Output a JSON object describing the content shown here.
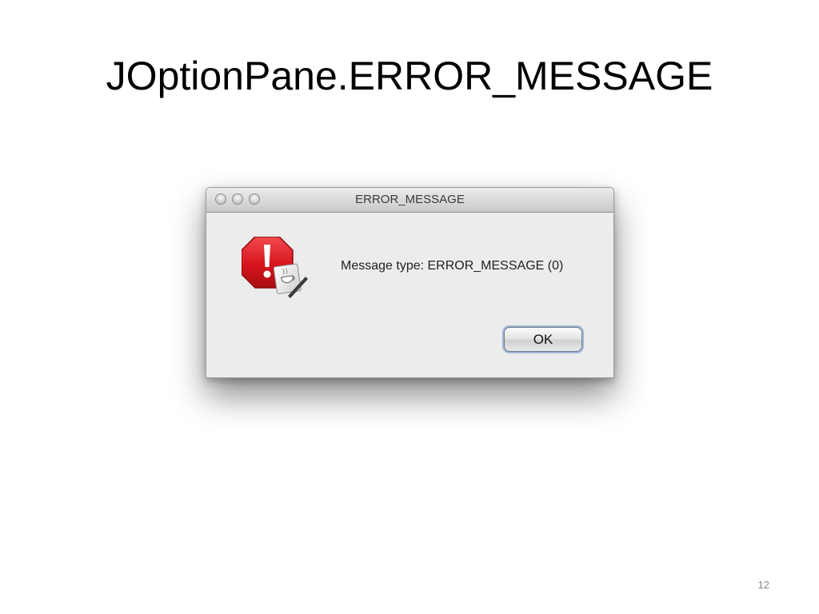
{
  "slide": {
    "title": "JOptionPane.ERROR_MESSAGE",
    "page_number": "12"
  },
  "dialog": {
    "window_title": "ERROR_MESSAGE",
    "message": "Message type: ERROR_MESSAGE (0)",
    "ok_label": "OK",
    "icon": "error-stop-sign-icon",
    "window_controls": [
      "close-button",
      "minimize-button",
      "zoom-button"
    ]
  },
  "colors": {
    "error_red": "#d7141c",
    "button_focus_ring": "#9db6d6",
    "dialog_background": "#ececec"
  }
}
